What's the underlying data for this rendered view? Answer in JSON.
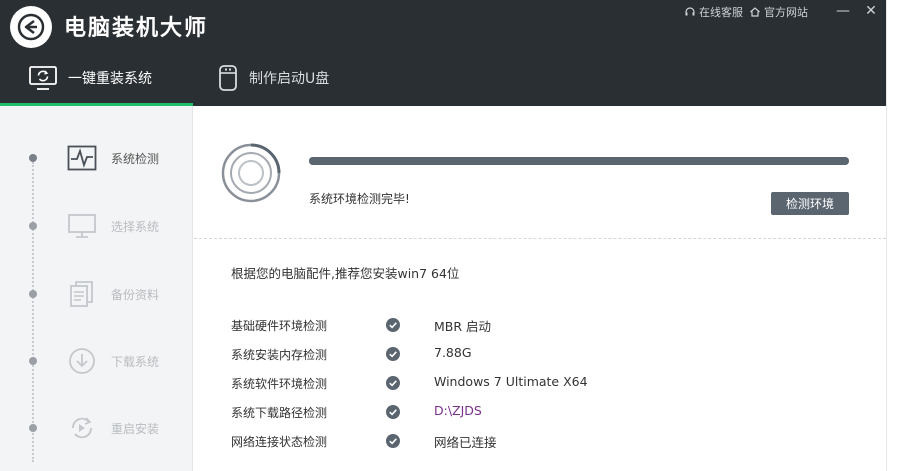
{
  "app": {
    "title": "电脑装机大师"
  },
  "top_links": [
    {
      "label": "在线客服",
      "icon": "headset-icon"
    },
    {
      "label": "官方网站",
      "icon": "home-icon"
    }
  ],
  "window_buttons": {
    "minimize": "—",
    "close": "✕"
  },
  "tabs": [
    {
      "label": "一键重装系统",
      "icon": "monitor-refresh-icon",
      "active": true
    },
    {
      "label": "制作启动U盘",
      "icon": "usb-drive-icon",
      "active": false
    }
  ],
  "steps": [
    {
      "label": "系统检测",
      "icon": "pulse-icon",
      "enabled": true
    },
    {
      "label": "选择系统",
      "icon": "monitor-icon",
      "enabled": false
    },
    {
      "label": "备份资料",
      "icon": "documents-icon",
      "enabled": false
    },
    {
      "label": "下载系统",
      "icon": "download-icon",
      "enabled": false
    },
    {
      "label": "重启安装",
      "icon": "restart-icon",
      "enabled": false
    }
  ],
  "scan": {
    "progress": 1.0,
    "status": "系统环境检测完毕!",
    "button_label": "检测环境"
  },
  "recommend_text": "根据您的电脑配件,推荐您安装win7 64位",
  "checks": [
    {
      "label": "基础硬件环境检测",
      "value": "MBR 启动"
    },
    {
      "label": "系统安装内存检测",
      "value": "7.88G"
    },
    {
      "label": "系统软件环境检测",
      "value": "Windows 7 Ultimate X64"
    },
    {
      "label": "系统下载路径检测",
      "value": "D:\\ZJDS"
    },
    {
      "label": "网络连接状态检测",
      "value": "网络已连接"
    }
  ],
  "colors": {
    "header": "#2a2f33",
    "accent": "#1fbf6a",
    "button": "#5b6570",
    "path": "#7b2f8e"
  }
}
